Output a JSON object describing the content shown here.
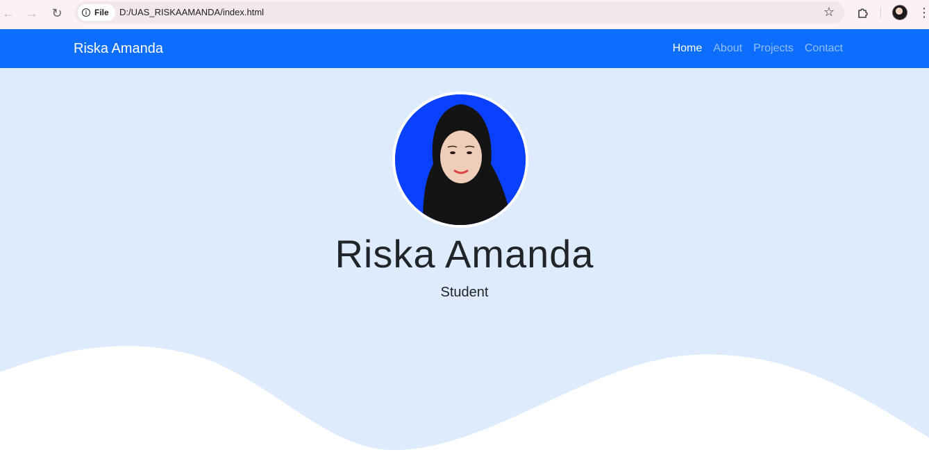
{
  "browser": {
    "back_icon": "arrow-left-icon",
    "forward_icon": "arrow-right-icon",
    "reload_icon": "reload-icon",
    "site_chip_label": "File",
    "url": "D:/UAS_RISKAAMANDA/index.html",
    "bookmark_icon": "star-icon",
    "extensions_icon": "puzzle-icon",
    "menu_icon": "kebab-menu-icon"
  },
  "navbar": {
    "brand": "Riska Amanda",
    "links": [
      {
        "label": "Home",
        "active": true
      },
      {
        "label": "About",
        "active": false
      },
      {
        "label": "Projects",
        "active": false
      },
      {
        "label": "Contact",
        "active": false
      }
    ],
    "color": "#0d6efd"
  },
  "hero": {
    "name": "Riska Amanda",
    "role": "Student",
    "background": "#deebfc"
  }
}
